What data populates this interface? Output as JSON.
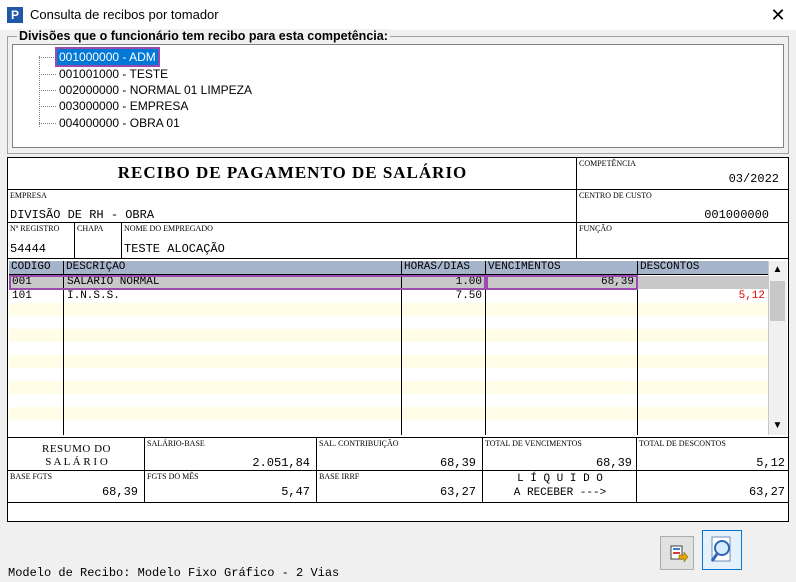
{
  "window": {
    "title": "Consulta de recibos por tomador",
    "icon_letter": "P",
    "close": "✕"
  },
  "divisions": {
    "legend": "Divisões que o funcionário tem recibo para esta competência:",
    "items": [
      {
        "label": "001000000 - ADM"
      },
      {
        "label": "001001000 - TESTE"
      },
      {
        "label": "002000000 - NORMAL 01 LIMPEZA"
      },
      {
        "label": "003000000 - EMPRESA"
      },
      {
        "label": "004000000 - OBRA 01"
      }
    ]
  },
  "receipt": {
    "title": "RECIBO DE PAGAMENTO DE SALÁRIO",
    "competencia_label": "COMPETÊNCIA",
    "competencia": "03/2022",
    "empresa_label": "EMPRESA",
    "empresa": "DIVISÃO DE RH - OBRA",
    "centro_label": "CENTRO DE CUSTO",
    "centro": "001000000",
    "registro_label": "Nº REGISTRO",
    "registro": "54444",
    "chapa_label": "CHAPA",
    "chapa": "",
    "empregado_label": "NOME DO EMPREGADO",
    "empregado": "TESTE ALOCAÇÃO",
    "funcao_label": "FUNÇÃO",
    "funcao": ""
  },
  "grid": {
    "headers": [
      "CÓDIGO",
      "DESCRIÇÃO",
      "HORAS/DIAS",
      "VENCIMENTOS",
      "DESCONTOS"
    ],
    "rows": [
      {
        "codigo": "001",
        "descricao": "SALÁRIO NORMAL",
        "horas": "1.00",
        "vencimentos": "68,39",
        "descontos": ""
      },
      {
        "codigo": "101",
        "descricao": "I.N.S.S.",
        "horas": "7.50",
        "vencimentos": "",
        "descontos": "5,12"
      }
    ],
    "colors": {
      "header": "#a6b4cb",
      "row_alt": "#fffde5",
      "selected": "#c8c8c8",
      "discount_text": "#e00000",
      "highlight": "#9b4ab0"
    }
  },
  "summary": {
    "resumo_line1": "RESUMO DO",
    "resumo_line2": "S A L Á R I O",
    "salario_base_label": "SALÁRIO-BASE",
    "salario_base": "2.051,84",
    "sal_contrib_label": "SAL. CONTRIBUIÇÃO",
    "sal_contrib": "68,39",
    "total_venc_label": "TOTAL DE VENCIMENTOS",
    "total_venc": "68,39",
    "total_desc_label": "TOTAL DE DESCONTOS",
    "total_desc": "5,12",
    "base_fgts_label": "BASE FGTS",
    "base_fgts": "68,39",
    "fgts_mes_label": "FGTS DO MÊS",
    "fgts_mes": "5,47",
    "base_irrf_label": "BASE IRRF",
    "base_irrf": "63,27",
    "liquido_line1": "L Í Q U I D O",
    "liquido_line2": "A RECEBER --->",
    "liquido": "63,27"
  },
  "footer": {
    "modelo": "Modelo de Recibo: Modelo Fixo Gráfico - 2 Vias"
  },
  "icons": {
    "export": "export-icon",
    "zoom": "magnifier-icon"
  }
}
